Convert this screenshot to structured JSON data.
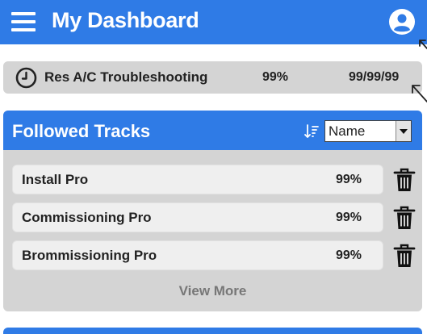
{
  "header": {
    "title": "My Dashboard",
    "menu_icon": "hamburger-menu-icon",
    "user_icon": "user-account-icon",
    "color": "#2f7be6"
  },
  "recent_track": {
    "icon": "clock-icon",
    "title": "Res A/C Troubleshooting",
    "progress": "99%",
    "date": "99/99/99"
  },
  "followed_tracks": {
    "title": "Followed Tracks",
    "sort_icon": "sort-icon",
    "sort": {
      "selected": "Name"
    },
    "items": [
      {
        "name": "Install Pro",
        "progress": "99%"
      },
      {
        "name": "Commissioning Pro",
        "progress": "99%"
      },
      {
        "name": "Brommissioning Pro",
        "progress": "99%"
      }
    ],
    "view_more_label": "View More"
  }
}
